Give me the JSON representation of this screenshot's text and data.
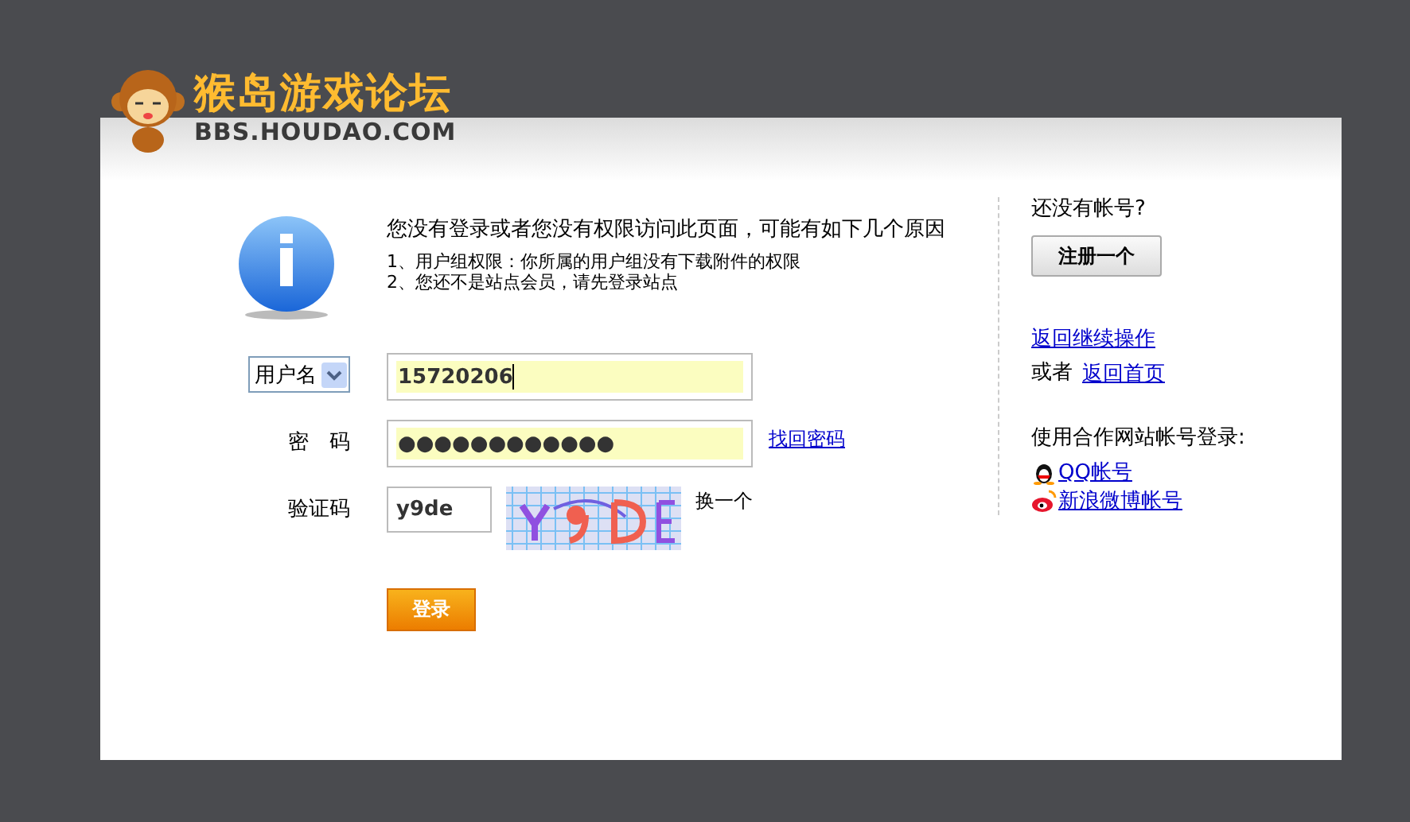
{
  "logo": {
    "title": "猴岛游戏论坛",
    "domain": "BBS.HOUDAO.COM"
  },
  "notice": {
    "heading": "您没有登录或者您没有权限访问此页面，可能有如下几个原因",
    "reasons": [
      "1、用户组权限：你所属的用户组没有下载附件的权限",
      "2、您还不是站点会员，请先登录站点"
    ]
  },
  "login": {
    "account_type": "用户名",
    "username": "15720206",
    "password_label": "密　码",
    "password": "●●●●●●●●●●●●",
    "forgot_link": "找回密码",
    "captcha_label": "验证码",
    "captcha": "y9de",
    "refresh_link": "换一个",
    "submit": "登录"
  },
  "sidebar": {
    "no_account": "还没有帐号?",
    "register": "注册一个",
    "continue_link": "返回继续操作",
    "or": "或者",
    "home_link": "返回首页",
    "partner_heading": "使用合作网站帐号登录:",
    "partners": [
      {
        "kind": "qq",
        "label": "QQ帐号"
      },
      {
        "kind": "weibo",
        "label": "新浪微博帐号"
      }
    ]
  }
}
